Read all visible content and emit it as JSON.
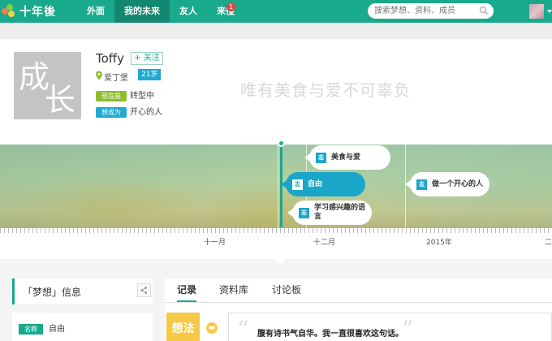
{
  "header": {
    "logo_text": "十年後",
    "nav": [
      "外面",
      "我的未来",
      "友人",
      "来往"
    ],
    "active_nav": "我的未来",
    "notification_count": "1",
    "search_placeholder": "搜索梦想、资料、成员"
  },
  "profile": {
    "photo_text": [
      "成",
      "长"
    ],
    "name": "Toffy",
    "follow_label": "+ 关注",
    "location": "爱丁堡",
    "age": "21岁",
    "status_now_label": "现在是",
    "status_now": "转型中",
    "want_label": "想成为",
    "want_value": "开心的人",
    "motto": "唯有美食与爱不可辜负"
  },
  "timeline": {
    "event_marker": "志",
    "events": [
      {
        "label": "美食与爱",
        "active": false
      },
      {
        "label": "自由",
        "active": true
      },
      {
        "label": "学习感兴趣的语言",
        "active": false
      },
      {
        "label": "做一个开心的人",
        "active": false
      }
    ],
    "months": [
      "十一月",
      "十二月",
      "2015年",
      "二"
    ]
  },
  "dream_info": {
    "title": "「梦想」信息",
    "name_label": "名称",
    "name_value": "自由"
  },
  "tabs": [
    "记录",
    "资料库",
    "讨论板"
  ],
  "active_tab": "记录",
  "record": {
    "idea_label": "想法",
    "quote": "腹有诗书气自华。我一直很喜欢这句话。"
  },
  "colors": {
    "brand": "#19a98b",
    "accent_blue": "#19a6c9",
    "tag_green": "#8dbd2c",
    "idea_yellow": "#f5c945"
  }
}
